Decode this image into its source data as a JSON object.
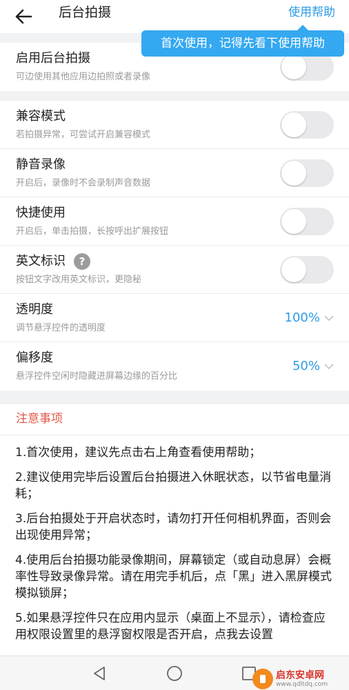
{
  "header": {
    "title": "后台拍摄",
    "help_label": "使用帮助",
    "back_icon": "arrow-left-icon"
  },
  "tooltip": {
    "text": "首次使用，记得先看下使用帮助"
  },
  "group1": {
    "items": [
      {
        "title": "启用后台拍摄",
        "subtitle": "可边使用其他应用边拍照或者录像",
        "enabled": false
      }
    ]
  },
  "group2": {
    "items": [
      {
        "title": "兼容模式",
        "subtitle": "若拍摄异常，可尝试开启兼容模式",
        "enabled": false
      },
      {
        "title": "静音录像",
        "subtitle": "开启后，录像时不会录制声音数据",
        "enabled": false
      },
      {
        "title": "快捷使用",
        "subtitle": "开启后，单击拍摄，长按呼出扩展按钮",
        "enabled": false
      },
      {
        "title": "英文标识",
        "subtitle": "按钮文字改用英文标识，更隐秘",
        "enabled": false,
        "help_icon": "?"
      },
      {
        "title": "透明度",
        "subtitle": "调节悬浮控件的透明度",
        "value": "100%"
      },
      {
        "title": "偏移度",
        "subtitle": "悬浮控件空闲时隐藏进屏幕边缘的百分比",
        "value": "50%"
      }
    ]
  },
  "notes": {
    "title": "注意事项",
    "items": [
      "1.首次使用，建议先点击右上角查看使用帮助；",
      "2.建议使用完毕后设置后台拍摄进入休眠状态，以节省电量消耗；",
      "3.后台拍摄处于开启状态时，请勿打开任何相机界面，否则会出现使用异常；",
      "4.使用后台拍摄功能录像期间，屏幕锁定（或自动息屏）会概率性导致录像异常。请在用完手机后，点「黑」进入黑屏模式模拟锁屏；",
      "5.如果悬浮控件只在应用内显示（桌面上不显示），请检查应用权限设置里的悬浮窗权限是否开启，点我去设置"
    ]
  },
  "navbar": {
    "back_icon": "triangle-back-icon",
    "home_icon": "circle-home-icon",
    "recents_icon": "square-recents-icon"
  },
  "watermark": {
    "name": "启东安卓网",
    "url": "www.qdltdq.com"
  },
  "colors": {
    "accent": "#2e9be6",
    "tooltip_bg": "#34a8f0",
    "notes_title": "#e05a4a",
    "toggle_off": "#e9e9ec"
  }
}
